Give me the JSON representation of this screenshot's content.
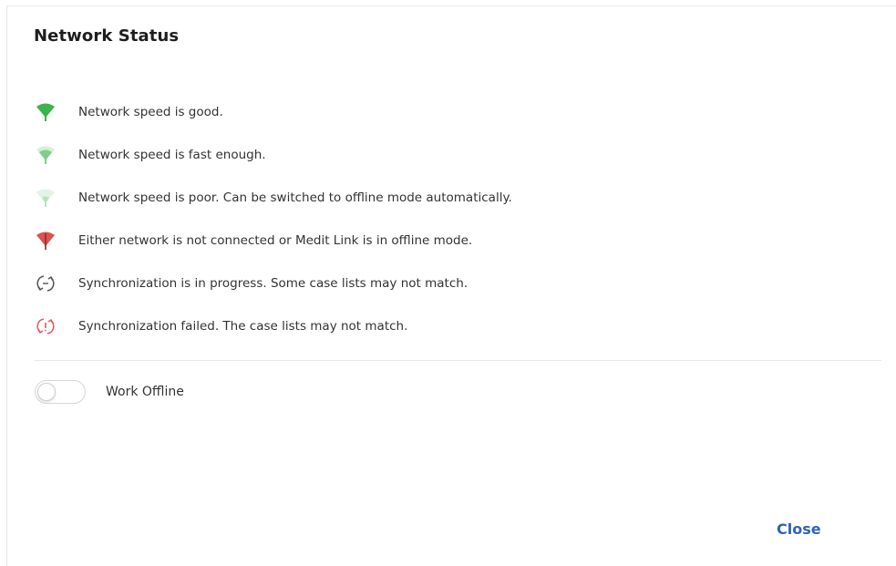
{
  "dialog": {
    "title": "Network Status",
    "statuses": [
      {
        "icon": "wifi-good-icon",
        "color": "#3cb44b",
        "text": "Network speed is good."
      },
      {
        "icon": "wifi-fast-enough-icon",
        "color": "#7fcf87",
        "text": "Network speed is fast enough."
      },
      {
        "icon": "wifi-poor-icon",
        "color": "#b9e3bd",
        "text": "Network speed is poor. Can be switched to offline mode automatically."
      },
      {
        "icon": "wifi-offline-icon",
        "color": "#d9534f",
        "text": "Either network is not connected or Medit Link is in offline mode."
      },
      {
        "icon": "sync-progress-icon",
        "color": "#555555",
        "text": "Synchronization is in progress. Some case lists may not match."
      },
      {
        "icon": "sync-failed-icon",
        "color": "#e05a5a",
        "text": "Synchronization failed. The case lists may not match."
      }
    ],
    "work_offline": {
      "label": "Work Offline",
      "enabled": false
    },
    "close_label": "Close"
  },
  "colors": {
    "accent": "#2e63b8"
  }
}
